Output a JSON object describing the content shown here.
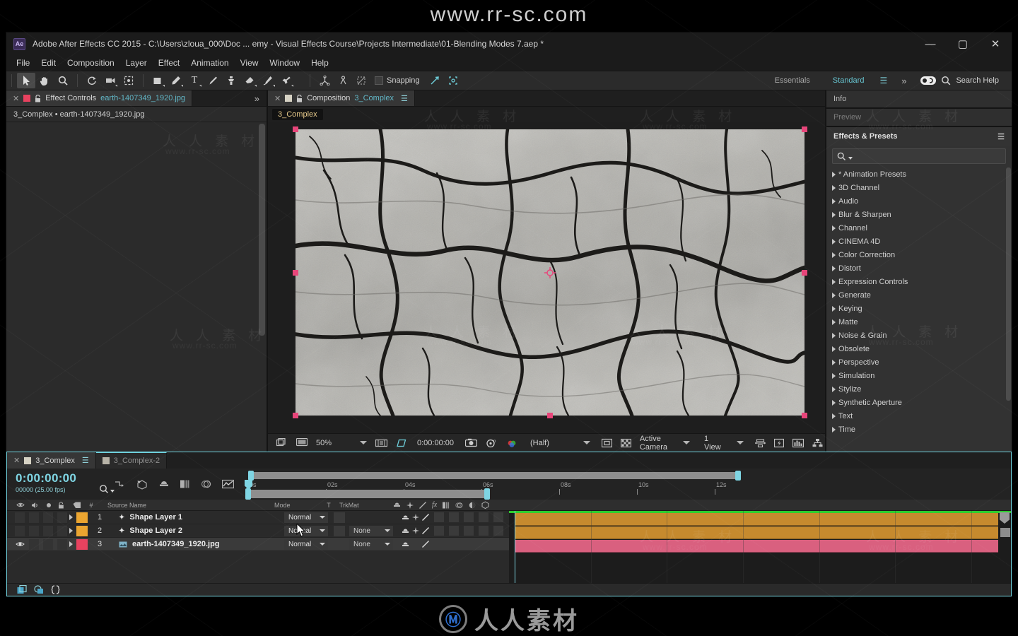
{
  "watermark": {
    "top_url": "www.rr-sc.com",
    "bottom_brand": "人人素材",
    "tile_cn": "人 人 素 材",
    "tile_url": "www.rr-sc.com"
  },
  "window": {
    "app_badge": "Ae",
    "title": "Adobe After Effects CC 2015 - C:\\Users\\zloua_000\\Doc ... emy - Visual Effects Course\\Projects Intermediate\\01-Blending Modes 7.aep *",
    "minimize": "—",
    "maximize": "▢",
    "close": "✕"
  },
  "menubar": {
    "items": [
      "File",
      "Edit",
      "Composition",
      "Layer",
      "Effect",
      "Animation",
      "View",
      "Window",
      "Help"
    ]
  },
  "toolbar": {
    "tools": [
      {
        "name": "selection-tool",
        "glyph": "➚",
        "active": true
      },
      {
        "name": "hand-tool",
        "glyph": "✋",
        "active": false
      },
      {
        "name": "zoom-tool",
        "glyph": "🔍",
        "active": false
      },
      {
        "name": "rotation-tool",
        "glyph": "↻",
        "active": false
      },
      {
        "name": "camera-tool",
        "glyph": "▣",
        "active": false
      },
      {
        "name": "pan-behind-tool",
        "glyph": "⬚",
        "active": false
      },
      {
        "name": "shape-tool",
        "glyph": "▢",
        "active": false
      },
      {
        "name": "pen-tool",
        "glyph": "✒",
        "active": false
      },
      {
        "name": "type-tool",
        "glyph": "T",
        "active": false
      },
      {
        "name": "brush-tool",
        "glyph": "⁄",
        "active": false
      },
      {
        "name": "clone-stamp-tool",
        "glyph": "⚲",
        "active": false
      },
      {
        "name": "eraser-tool",
        "glyph": "▰",
        "active": false
      },
      {
        "name": "roto-brush-tool",
        "glyph": "⑂",
        "active": false
      },
      {
        "name": "puppet-pin-tool",
        "glyph": "✚",
        "active": false
      }
    ],
    "snapping_label": "Snapping",
    "workspace_essentials": "Essentials",
    "workspace_standard": "Standard",
    "menu_glyph": "☰",
    "overflow_glyph": "»",
    "search_help": "Search Help"
  },
  "effect_controls": {
    "tab_title": "Effect Controls",
    "tab_target": "earth-1407349_1920.jpg",
    "close_glyph": "✕",
    "lock_glyph": "🔒",
    "overflow_glyph": "»",
    "subheader": "3_Complex • earth-1407349_1920.jpg"
  },
  "composition": {
    "tab_title": "Composition",
    "tab_target": "3_Complex",
    "close_glyph": "✕",
    "lock_glyph": "🔒",
    "menu_glyph": "☰",
    "viewer_tab": "3_Complex",
    "bottom_bar": {
      "zoom": "50%",
      "timecode": "0:00:00:00",
      "resolution": "(Half)",
      "camera": "Active Camera",
      "views": "1 View"
    }
  },
  "right_panel": {
    "info_title": "Info",
    "preview_title": "Preview",
    "effects_title": "Effects & Presets",
    "effects_menu_glyph": "☰",
    "search_placeholder": "",
    "categories": [
      "* Animation Presets",
      "3D Channel",
      "Audio",
      "Blur & Sharpen",
      "Channel",
      "CINEMA 4D",
      "Color Correction",
      "Distort",
      "Expression Controls",
      "Generate",
      "Keying",
      "Matte",
      "Noise & Grain",
      "Obsolete",
      "Perspective",
      "Simulation",
      "Stylize",
      "Synthetic Aperture",
      "Text",
      "Time"
    ]
  },
  "timeline": {
    "tabs": [
      {
        "label": "3_Complex",
        "active": true,
        "close_glyph": "✕",
        "menu_glyph": "☰"
      },
      {
        "label": "3_Complex-2",
        "active": false
      }
    ],
    "current_time": "0:00:00:00",
    "frame_info": "00000 (25.00 fps)",
    "columns": {
      "source_name": "Source Name",
      "number": "#",
      "mode": "Mode",
      "t": "T",
      "trkmat": "TrkMat"
    },
    "ruler_ticks": [
      "0s",
      "02s",
      "04s",
      "06s",
      "08s",
      "10s",
      "12s"
    ],
    "layers": [
      {
        "index": "1",
        "name": "Shape Layer 1",
        "mode": "Normal",
        "trkmat": "",
        "color": "#eba530",
        "visible": false,
        "bar_color": "#c68a2e",
        "type_icon": "★"
      },
      {
        "index": "2",
        "name": "Shape Layer 2",
        "mode": "Normal",
        "trkmat": "None",
        "color": "#eba530",
        "visible": false,
        "bar_color": "#c68a2e",
        "type_icon": "★"
      },
      {
        "index": "3",
        "name": "earth-1407349_1920.jpg",
        "mode": "Normal",
        "trkmat": "None",
        "color": "#e8425f",
        "visible": true,
        "bar_color": "#d9607f",
        "type_icon": "▤"
      }
    ]
  },
  "colors": {
    "accent_cyan": "#6fd2de",
    "selection_pink": "#e8457a",
    "work_area_green": "#2ecc2e",
    "layer_orange": "#c68a2e",
    "layer_pink": "#d9607f",
    "app_bg": "#2b2b2b"
  }
}
